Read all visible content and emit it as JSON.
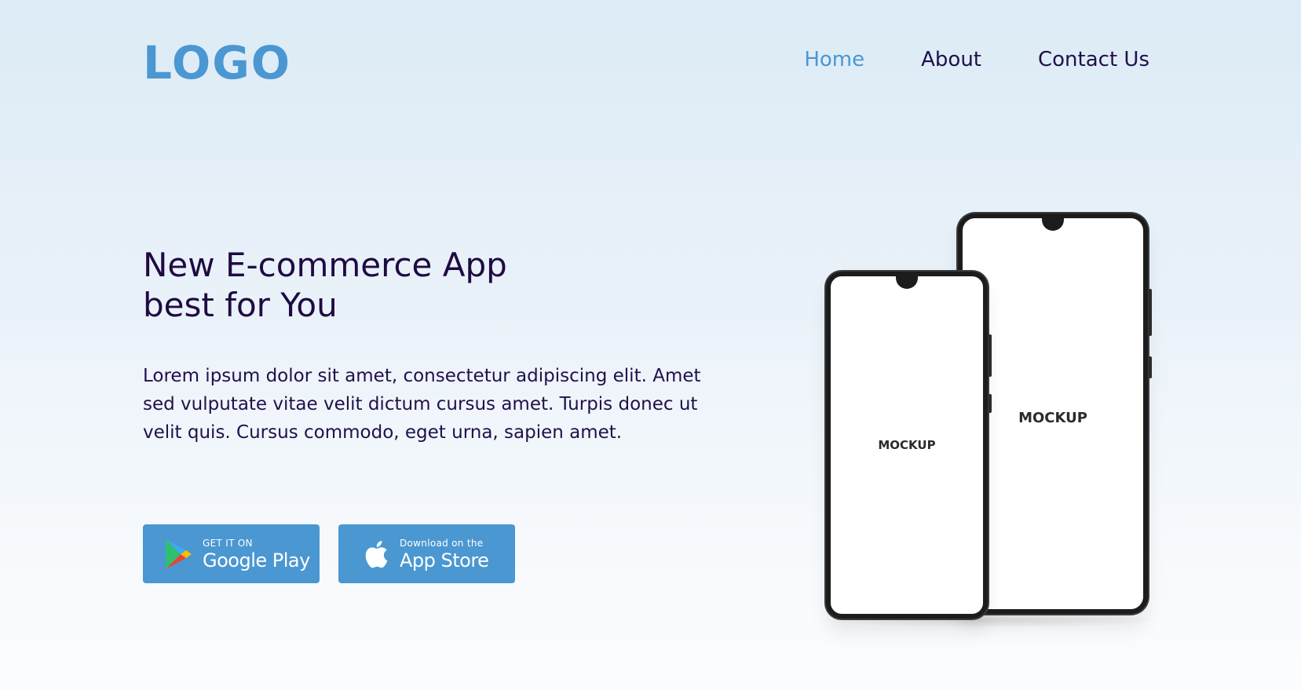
{
  "header": {
    "logo": "LOGO",
    "nav": [
      {
        "label": "Home",
        "active": true
      },
      {
        "label": "About",
        "active": false
      },
      {
        "label": "Contact Us",
        "active": false
      }
    ]
  },
  "hero": {
    "title_line1": "New E-commerce App",
    "title_line2": "best for You",
    "description": "Lorem ipsum dolor sit amet, consectetur adipiscing elit. Amet sed vulputate vitae velit dictum cursus amet. Turpis donec ut velit quis. Cursus commodo, eget urna, sapien amet."
  },
  "store_buttons": {
    "google": {
      "small": "GET IT ON",
      "big": "Google Play",
      "icon": "google-play-icon"
    },
    "apple": {
      "small": "Download on the",
      "big": "App Store",
      "icon": "apple-icon"
    }
  },
  "mockups": {
    "front_label": "MOCKUP",
    "back_label": "MOCKUP"
  },
  "colors": {
    "accent": "#4a97d2",
    "text_dark": "#1f0a42",
    "background_top": "#dcebf6",
    "background_bottom": "#fbfcfe"
  }
}
